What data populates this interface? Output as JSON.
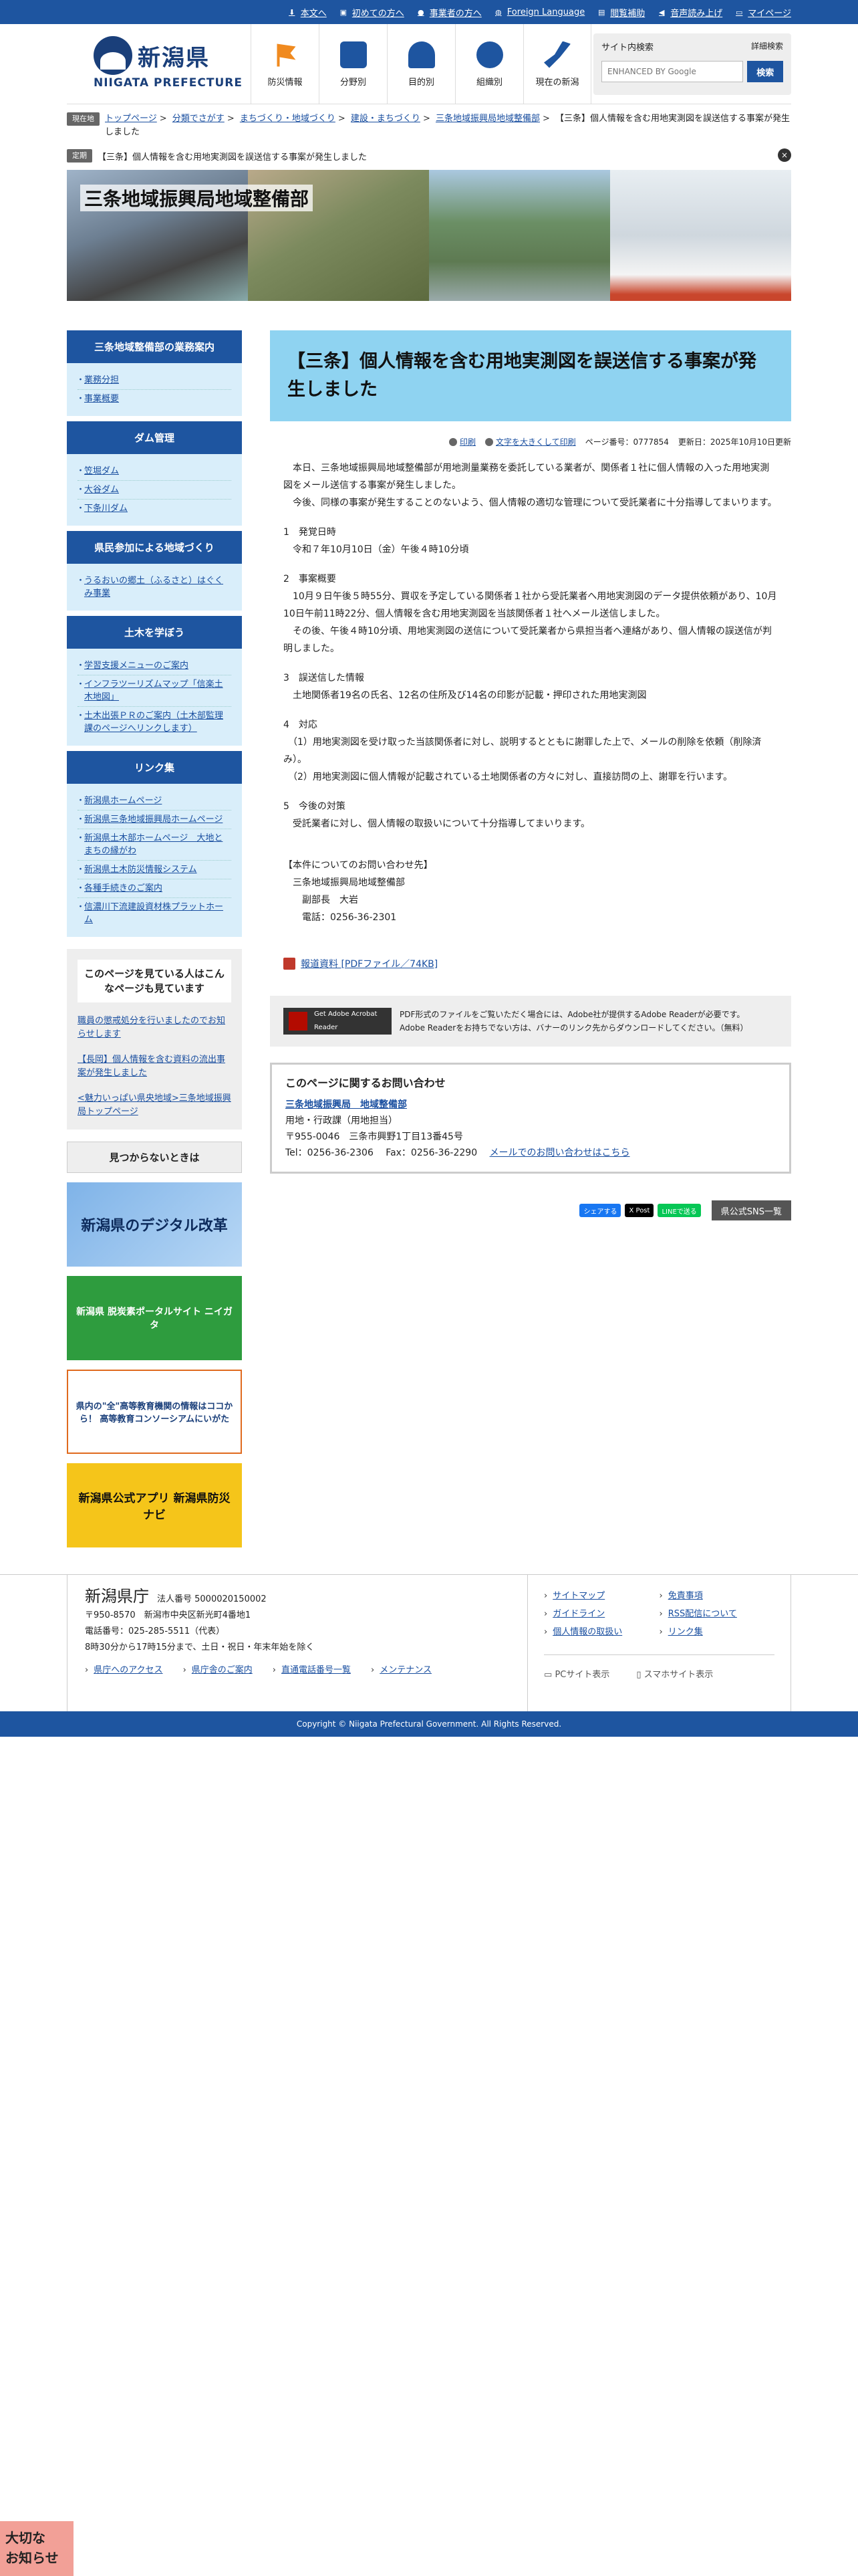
{
  "utility": {
    "items": [
      {
        "label": "本文へ",
        "icon": "down-arrow-icon"
      },
      {
        "label": "初めての方へ",
        "icon": "beginner-icon"
      },
      {
        "label": "事業者の方へ",
        "icon": "person-icon"
      },
      {
        "label": "Foreign Language",
        "icon": "globe-icon"
      },
      {
        "label": "閲覧補助",
        "icon": "accessibility-icon"
      },
      {
        "label": "音声読み上げ",
        "icon": "speaker-icon"
      },
      {
        "label": "マイページ",
        "icon": "folder-icon"
      }
    ]
  },
  "logo": {
    "jp": "新潟県",
    "en": "NIIGATA PREFECTURE"
  },
  "gnav": [
    {
      "label": "防災情報",
      "color": "#f08a1f"
    },
    {
      "label": "分野別",
      "color": "#1e55a0"
    },
    {
      "label": "目的別",
      "color": "#1e55a0"
    },
    {
      "label": "組織別",
      "color": "#1e55a0"
    },
    {
      "label": "現在の新潟",
      "color": "#1e55a0"
    }
  ],
  "search": {
    "title": "サイト内検索",
    "advanced": "詳細検索",
    "placeholder": "ENHANCED BY Google",
    "button": "検索"
  },
  "breadcrumb": {
    "tag": "現在地",
    "items": [
      "トップページ",
      "分類でさがす",
      "まちづくり・地域づくり",
      "建設・まちづくり",
      "三条地域振興局地域整備部"
    ],
    "current": "【三条】個人情報を含む用地実測図を誤送信する事案が発生しました"
  },
  "notice": {
    "tag": "定期",
    "text": "【三条】個人情報を含む用地実測図を誤送信する事案が発生しました",
    "close": "×"
  },
  "banner": {
    "title": "三条地域振興局地域整備部"
  },
  "sidebar": {
    "sections": [
      {
        "title": "三条地域整備部の業務案内",
        "items": [
          "業務分担",
          "事業概要"
        ]
      },
      {
        "title": "ダム管理",
        "items": [
          "笠堀ダム",
          "大谷ダム",
          "下条川ダム"
        ]
      },
      {
        "title": "県民参加による地域づくり",
        "items": [
          "うるおいの郷土（ふるさと）はぐくみ事業"
        ]
      },
      {
        "title": "土木を学ぼう",
        "items": [
          "学習支援メニューのご案内",
          "インフラツーリズムマップ「信楽土木地図」",
          "土木出張ＰＲのご案内（土木部監理課のページへリンクします）"
        ]
      },
      {
        "title": "リンク集",
        "items": [
          "新潟県ホームページ",
          "新潟県三条地域振興局ホームページ",
          "新潟県土木部ホームページ　大地とまちの縁がわ",
          "新潟県土木防災情報システム",
          "各種手続きのご案内",
          "信濃川下流建設資材株プラットホーム"
        ]
      }
    ],
    "seealso_title": "このページを見ている人はこんなページも見ています",
    "seealso_items": [
      "職員の懲戒処分を行いましたのでお知らせします",
      "【長岡】個人情報を含む資料の流出事案が発生しました",
      "<魅力いっぱい県央地域>三条地域振興局トップページ"
    ],
    "notfound": "見つからないときは",
    "banners": [
      "新潟県のデジタル改革",
      "新潟県 脱炭素ポータルサイト ニイガタ",
      "県内の\"全\"高等教育機関の情報はココから！ 高等教育コンソーシアムにいがた",
      "新潟県公式アプリ 新潟県防災ナビ"
    ]
  },
  "page": {
    "title": "【三条】個人情報を含む用地実測図を誤送信する事案が発生しました",
    "tools": {
      "print": "印刷",
      "fontsize": "文字を大きくして印刷",
      "page_no": "ページ番号：0777854",
      "updated": "更新日：2025年10月10日更新"
    },
    "paragraphs": [
      "　本日、三条地域振興局地域整備部が用地測量業務を委託している業者が、関係者１社に個人情報の入った用地実測図をメール送信する事案が発生しました。",
      "　今後、同様の事案が発生することのないよう、個人情報の適切な管理について受託業者に十分指導してまいります。",
      "",
      "1　発覚日時",
      "　令和７年10月10日（金）午後４時10分頃",
      "",
      "2　事案概要",
      "　10月９日午後５時55分、買収を予定している関係者１社から受託業者へ用地実測図のデータ提供依頼があり、10月10日午前11時22分、個人情報を含む用地実測図を当該関係者１社へメール送信しました。",
      "　その後、午後４時10分頃、用地実測図の送信について受託業者から県担当者へ連絡があり、個人情報の誤送信が判明しました。",
      "",
      "3　誤送信した情報",
      "　土地関係者19名の氏名、12名の住所及び14名の印影が記載・押印された用地実測図",
      "",
      "4　対応",
      "　（1）用地実測図を受け取った当該関係者に対し、説明するとともに謝罪した上で、メールの削除を依頼（削除済み）。",
      "　（2）用地実測図に個人情報が記載されている土地関係者の方々に対し、直接訪問の上、謝罪を行います。",
      "",
      "5　今後の対策",
      "　受託業者に対し、個人情報の取扱いについて十分指導してまいります。",
      "",
      "",
      "【本件についてのお問い合わせ先】",
      "　三条地域振興局地域整備部",
      "　　副部長　大岩",
      "　　電話：0256-36-2301"
    ],
    "pdf": "報道資料 [PDFファイル／74KB]",
    "reader": {
      "badge": "Get Adobe Acrobat Reader",
      "text1": "PDF形式のファイルをご覧いただく場合には、Adobe社が提供するAdobe Readerが必要です。",
      "text2": "Adobe Readerをお持ちでない方は、バナーのリンク先からダウンロードしてください。（無料）"
    },
    "contact": {
      "title": "このページに関するお問い合わせ",
      "dept": "三条地域振興局　地域整備部",
      "section": "用地・行政課（用地担当）",
      "address": "〒955-0046　三条市興野1丁目13番45号",
      "tel": "Tel：0256-36-2306　 Fax：0256-36-2290",
      "mail": "メールでのお問い合わせはこちら"
    },
    "share": {
      "fb": "シェアする",
      "x": "X Post",
      "line": "LINEで送る",
      "sns": "県公式SNS一覧"
    }
  },
  "footer": {
    "name": "新潟県庁",
    "corp_no": "法人番号 5000020150002",
    "address": "〒950-8570　新潟市中央区新光町4番地1",
    "tel": "電話番号：025-285-5511（代表）",
    "hours": "8時30分から17時15分まで、土日・祝日・年末年始を除く",
    "links": [
      "県庁へのアクセス",
      "県庁舎のご案内",
      "直通電話番号一覧",
      "メンテナンス"
    ],
    "right_links": [
      "サイトマップ",
      "免責事項",
      "ガイドライン",
      "RSS配信について",
      "個人情報の取扱い",
      "リンク集"
    ],
    "pc": "PCサイト表示",
    "sp": "スマホサイト表示"
  },
  "copyright": "Copyright © Niigata Prefectural Government. All Rights Reserved.",
  "floatbtn": "大切な\nお知らせ"
}
